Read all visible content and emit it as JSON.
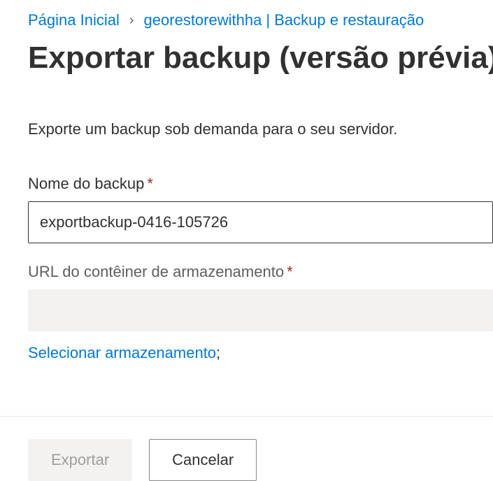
{
  "breadcrumb": {
    "home": "Página Inicial",
    "current": "georestorewithha | Backup e restauração"
  },
  "page": {
    "title": "Exportar backup (versão prévia)",
    "description": "Exporte um backup sob demanda para o seu servidor."
  },
  "form": {
    "backup_name": {
      "label": "Nome do backup",
      "value": "exportbackup-0416-105726"
    },
    "storage_url": {
      "label": "URL do contêiner de armazenamento",
      "value": ""
    },
    "select_storage_link": "Selecionar armazenamento",
    "select_storage_suffix": ";"
  },
  "actions": {
    "export": "Exportar",
    "cancel": "Cancelar"
  }
}
